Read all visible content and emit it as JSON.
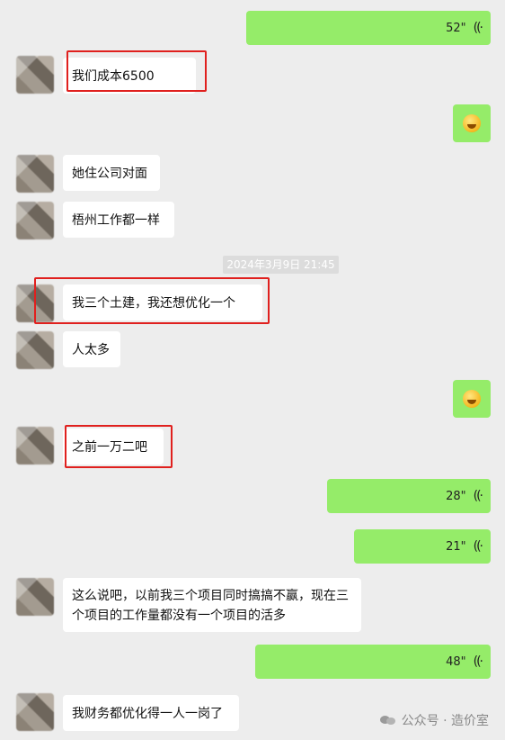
{
  "messages": [
    {
      "side": "right",
      "type": "voice",
      "duration": "52\"",
      "icon": "voice-waves-icon"
    },
    {
      "side": "left",
      "type": "text",
      "text": "我们成本6500",
      "highlighted": true
    },
    {
      "side": "right",
      "type": "emoji",
      "emoji": "laughing-face-icon"
    },
    {
      "side": "left",
      "type": "text",
      "text": "她住公司对面"
    },
    {
      "side": "left",
      "type": "text",
      "text": "梧州工作都一样"
    },
    {
      "type": "timestamp",
      "text": "2024年3月9日 21:45"
    },
    {
      "side": "left",
      "type": "text",
      "text": "我三个土建，我还想优化一个",
      "highlighted": true
    },
    {
      "side": "left",
      "type": "text",
      "text": "人太多"
    },
    {
      "side": "right",
      "type": "emoji",
      "emoji": "grinning-face-icon"
    },
    {
      "side": "left",
      "type": "text",
      "text": "之前一万二吧",
      "highlighted": true
    },
    {
      "side": "right",
      "type": "voice",
      "duration": "28\"",
      "icon": "voice-waves-icon"
    },
    {
      "side": "right",
      "type": "voice",
      "duration": "21\"",
      "icon": "voice-waves-icon"
    },
    {
      "side": "left",
      "type": "text",
      "text": "这么说吧，以前我三个项目同时搞搞不赢，现在三个项目的工作量都没有一个项目的活多"
    },
    {
      "side": "right",
      "type": "voice",
      "duration": "48\"",
      "icon": "voice-waves-icon"
    },
    {
      "side": "left",
      "type": "text",
      "text": "我财务都优化得一人一岗了"
    }
  ],
  "watermark": {
    "text": "公众号 · 造价室",
    "icon": "wechat-icon"
  },
  "colors": {
    "sent_bubble": "#95ec69",
    "received_bubble": "#ffffff",
    "highlight": "#e0201e",
    "background": "#ededed"
  }
}
